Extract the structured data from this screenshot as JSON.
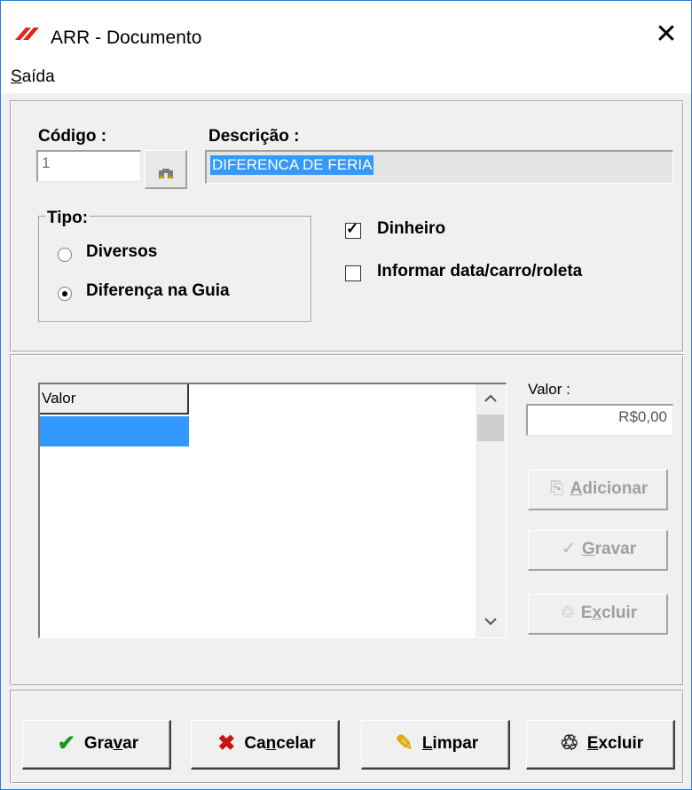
{
  "window": {
    "title": "ARR - Documento",
    "close_glyph": "✕",
    "accent": "#2b7fd8",
    "logo_color": "#e1261c"
  },
  "menu": {
    "items": [
      {
        "label_mnemonic": "S",
        "label_rest": "aída"
      }
    ]
  },
  "form": {
    "codigo_label": "Código :",
    "codigo_value": "1",
    "descricao_label": "Descrição :",
    "descricao_value": "DIFERENCA DE FERIA",
    "tipo_label": "Tipo:",
    "tipo_options": [
      {
        "label": "Diversos",
        "selected": false
      },
      {
        "label": "Diferença na Guia",
        "selected": true
      }
    ],
    "checkboxes": [
      {
        "label": "Dinheiro",
        "checked": true
      },
      {
        "label": "Informar data/carro/roleta",
        "checked": false
      }
    ]
  },
  "grid": {
    "columns": [
      "Valor"
    ],
    "rows": [
      ""
    ],
    "scroll_up": "ˆ",
    "scroll_down": "ˇ"
  },
  "valor": {
    "label": "Valor :",
    "value": "R$0,00"
  },
  "side_buttons": [
    {
      "icon": "add-document-icon",
      "glyph": "⎘",
      "mnemonic": "A",
      "rest": "dicionar",
      "enabled": false
    },
    {
      "icon": "check-icon",
      "glyph": "✓",
      "mnemonic": "G",
      "rest": "ravar",
      "enabled": false
    },
    {
      "icon": "trash-icon",
      "glyph": "♲",
      "pre": "E",
      "mnemonic": "x",
      "rest": "cluir",
      "enabled": false
    }
  ],
  "bottom_buttons": [
    {
      "icon": "check-icon",
      "glyph": "✔",
      "glyph_color": "#1a9a1a",
      "pre": "Gra",
      "mnemonic": "v",
      "rest": "ar"
    },
    {
      "icon": "x-icon",
      "glyph": "✖",
      "glyph_color": "#cc1111",
      "pre": "Ca",
      "mnemonic": "n",
      "rest": "celar"
    },
    {
      "icon": "eraser-icon",
      "glyph": "✎",
      "glyph_color": "#e0a800",
      "pre": "",
      "mnemonic": "L",
      "rest": "impar"
    },
    {
      "icon": "trash-icon",
      "glyph": "♲",
      "glyph_color": "#222222",
      "pre": "",
      "mnemonic": "E",
      "rest": "xcluir"
    }
  ]
}
